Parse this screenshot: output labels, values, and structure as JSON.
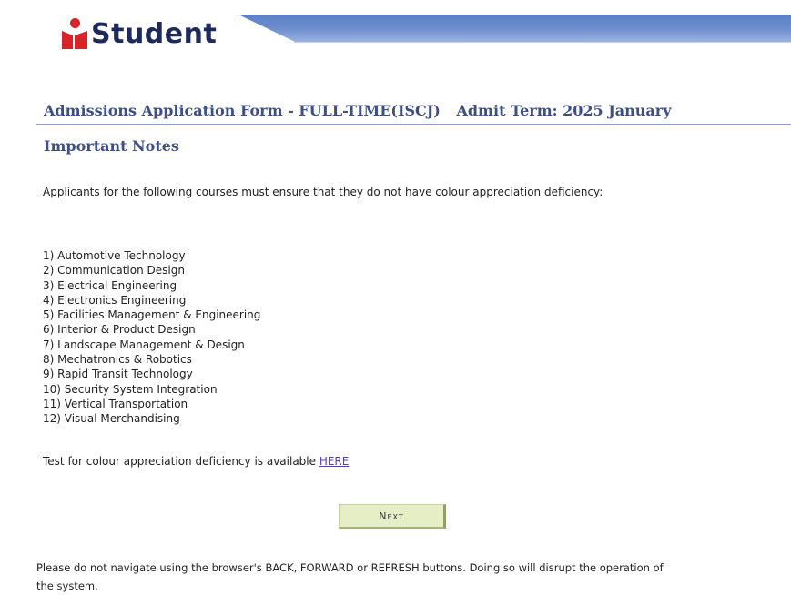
{
  "header": {
    "logo_text": "Student"
  },
  "form": {
    "title": "Admissions Application Form - FULL-TIME(ISCJ)",
    "admit_term": "Admit Term: 2025 January"
  },
  "notes": {
    "heading": "Important Notes",
    "intro": "Applicants for the following courses must ensure that they do not have colour appreciation deficiency:",
    "courses": [
      "1) Automotive Technology",
      "2) Communication Design",
      "3) Electrical Engineering",
      "4) Electronics Engineering",
      "5) Facilities Management & Engineering",
      "6) Interior & Product Design",
      "7) Landscape Management & Design",
      "8) Mechatronics & Robotics",
      "9) Rapid Transit Technology",
      "10) Security System Integration",
      "11) Vertical Transportation",
      "12) Visual Merchandising"
    ],
    "test_text": "Test for colour appreciation deficiency is available ",
    "test_link": "HERE"
  },
  "actions": {
    "next_label": "Next"
  },
  "footer": {
    "warning": "Please do not navigate using the browser's BACK, FORWARD or REFRESH buttons. Doing so will disrupt the operation of the system."
  },
  "colors": {
    "title": "#3d4f86",
    "logo_red": "#d8232a",
    "logo_text": "#1f2a5c",
    "header_band": "#6f90cf",
    "button_bg": "#e5eec4",
    "link": "#5a3fa8"
  }
}
